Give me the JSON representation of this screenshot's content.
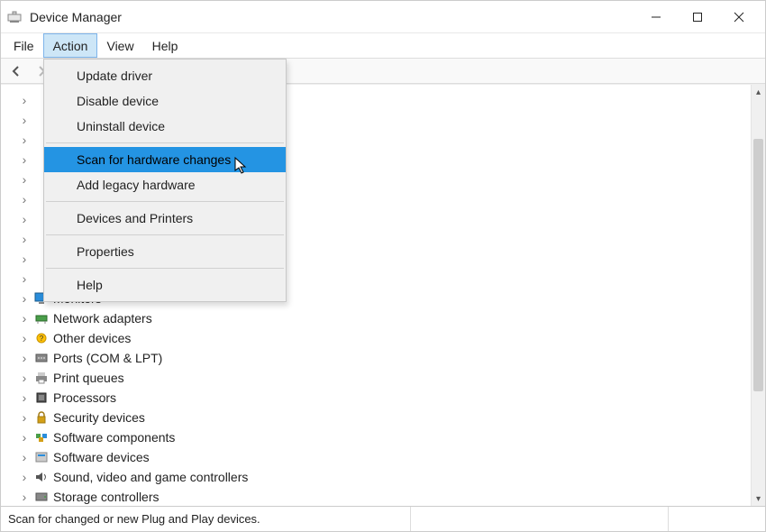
{
  "window": {
    "title": "Device Manager"
  },
  "menubar": {
    "items": [
      {
        "label": "File"
      },
      {
        "label": "Action"
      },
      {
        "label": "View"
      },
      {
        "label": "Help"
      }
    ]
  },
  "dropdown": {
    "items": [
      {
        "label": "Update driver"
      },
      {
        "label": "Disable device"
      },
      {
        "label": "Uninstall device"
      },
      {
        "sep": true
      },
      {
        "label": "Scan for hardware changes",
        "highlight": true
      },
      {
        "label": "Add legacy hardware"
      },
      {
        "sep": true
      },
      {
        "label": "Devices and Printers"
      },
      {
        "sep": true
      },
      {
        "label": "Properties"
      },
      {
        "sep": true
      },
      {
        "label": "Help"
      }
    ]
  },
  "tree": {
    "items": [
      {
        "label": "Monitors",
        "icon": "monitor"
      },
      {
        "label": "Network adapters",
        "icon": "network"
      },
      {
        "label": "Other devices",
        "icon": "other"
      },
      {
        "label": "Ports (COM & LPT)",
        "icon": "port"
      },
      {
        "label": "Print queues",
        "icon": "printer"
      },
      {
        "label": "Processors",
        "icon": "cpu"
      },
      {
        "label": "Security devices",
        "icon": "security"
      },
      {
        "label": "Software components",
        "icon": "component"
      },
      {
        "label": "Software devices",
        "icon": "softdev"
      },
      {
        "label": "Sound, video and game controllers",
        "icon": "sound"
      },
      {
        "label": "Storage controllers",
        "icon": "storage"
      }
    ]
  },
  "statusbar": {
    "text": "Scan for changed or new Plug and Play devices."
  }
}
